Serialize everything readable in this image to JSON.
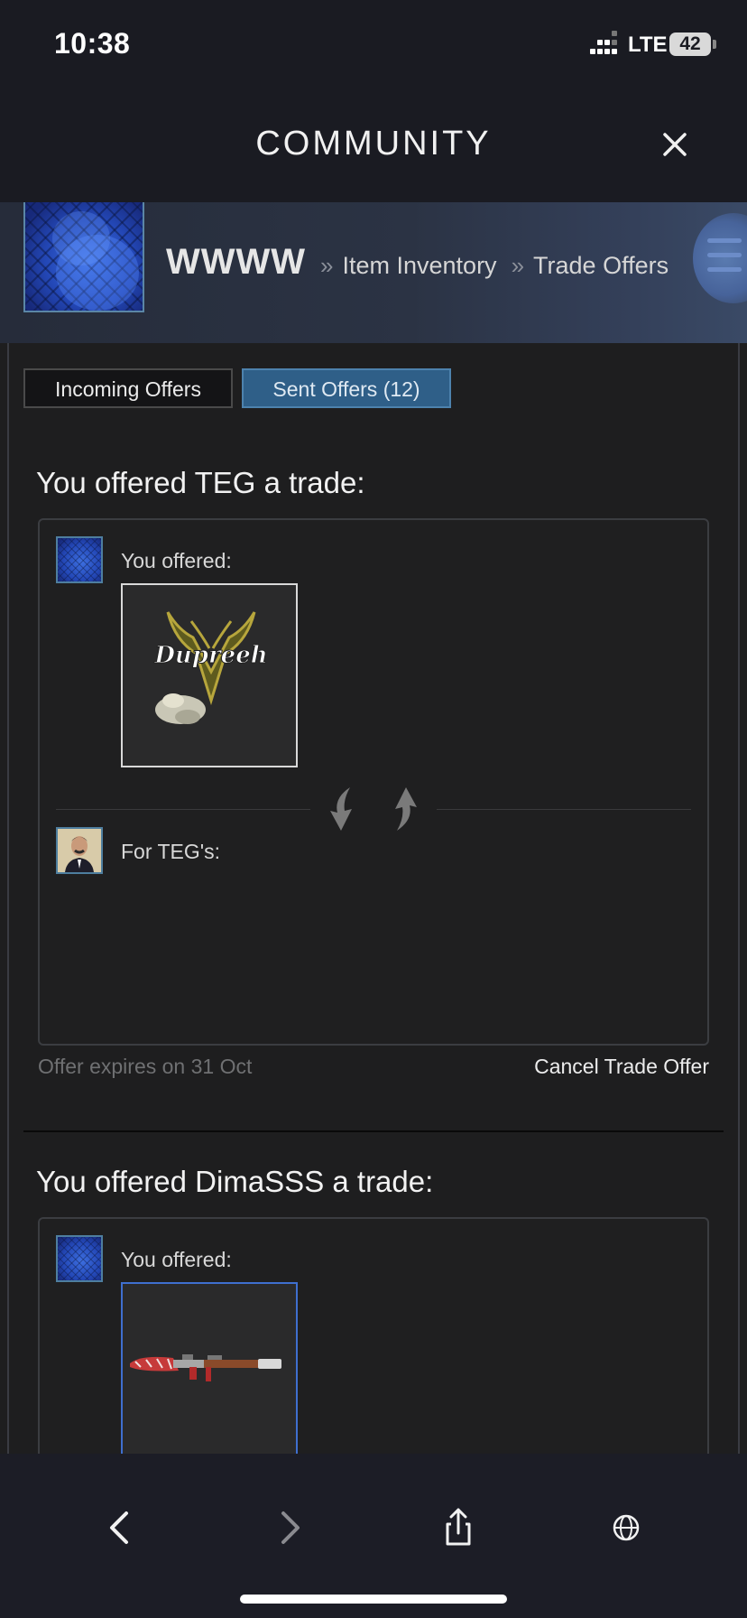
{
  "status_bar": {
    "time": "10:38",
    "network": "LTE",
    "battery": "42"
  },
  "header": {
    "title": "COMMUNITY",
    "close_icon": "close-icon"
  },
  "profile": {
    "username": "WWWW",
    "separator": "»",
    "breadcrumb_inventory": "Item Inventory",
    "breadcrumb_trade": "Trade Offers",
    "menu_icon": "hamburger-menu-icon"
  },
  "tabs": {
    "incoming": "Incoming Offers",
    "sent": "Sent Offers (12)"
  },
  "offers": [
    {
      "heading": "You offered TEG a trade:",
      "you_offered_label": "You offered:",
      "item_icon": "sticker-item-icon",
      "item_sticker_text": "Dupreeh",
      "for_label": "For TEG's:",
      "expires": "Offer expires on 31 Oct",
      "cancel": "Cancel Trade Offer"
    },
    {
      "heading": "You offered DimaSSS a trade:",
      "you_offered_label": "You offered:",
      "item_icon": "rocket-launcher-item-icon"
    }
  ],
  "toolbar": {
    "back_icon": "chevron-left-icon",
    "forward_icon": "chevron-right-icon",
    "share_icon": "share-icon",
    "globe_icon": "globe-icon"
  },
  "colors": {
    "accent_tab": "#2f5f88",
    "background": "#1e1e1f",
    "header": "#1a1b22"
  }
}
